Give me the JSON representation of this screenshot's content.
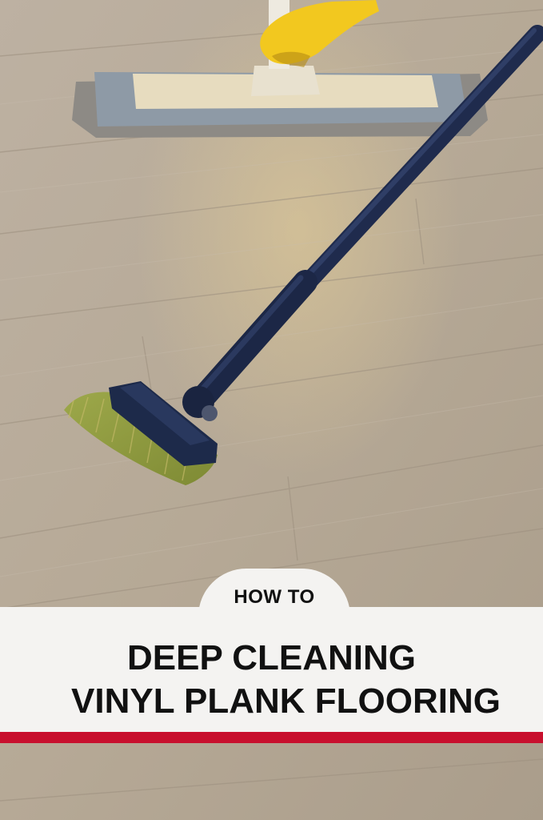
{
  "overlay": {
    "kicker": "HOW TO",
    "title_line_1": "DEEP CLEANING",
    "title_line_2": "VINYL PLANK FLOORING",
    "accent_color": "#c8102e"
  }
}
